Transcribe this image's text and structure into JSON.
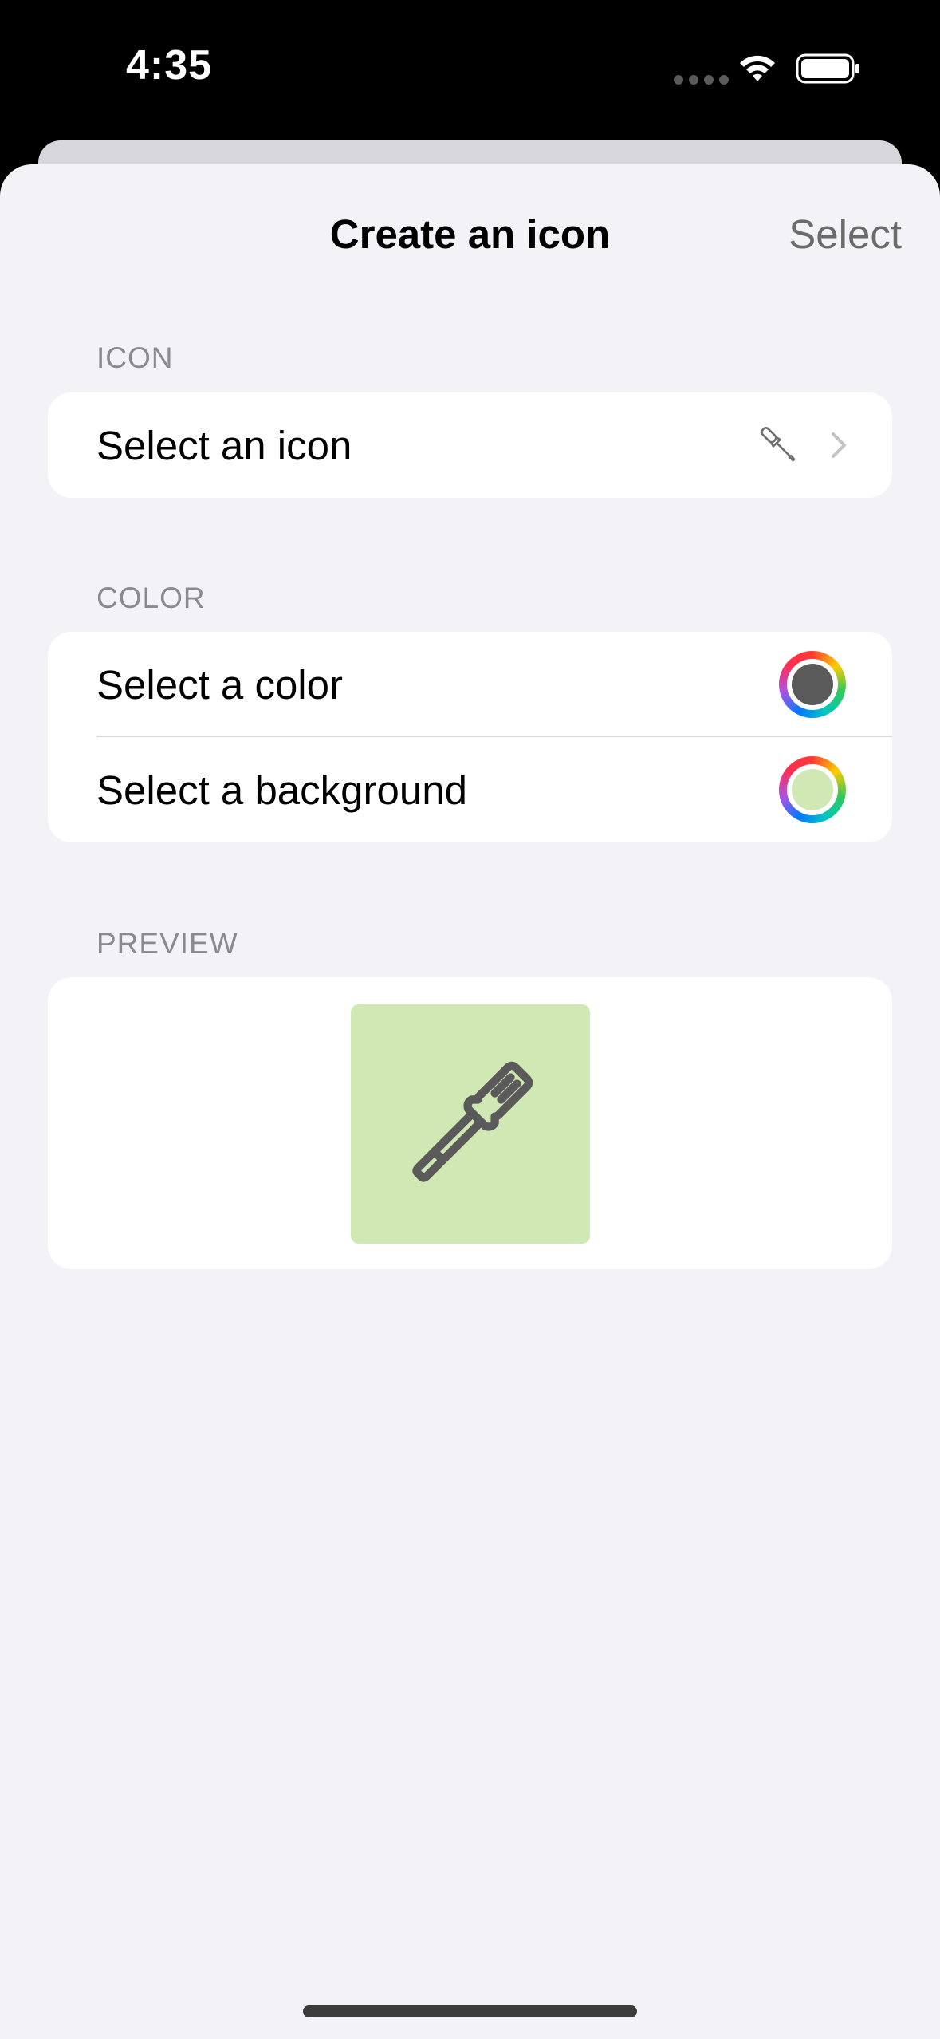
{
  "status_bar": {
    "time": "4:35",
    "wifi_icon": "wifi-icon",
    "battery_icon": "battery-icon"
  },
  "nav": {
    "title": "Create an icon",
    "action_label": "Select"
  },
  "icon_section": {
    "header": "ICON",
    "row_label": "Select an icon",
    "selected_icon": "screwdriver-icon"
  },
  "color_section": {
    "header": "COLOR",
    "rows": [
      {
        "label": "Select a color",
        "value": "#5a5a5a"
      },
      {
        "label": "Select a background",
        "value": "#cfe8b4"
      }
    ]
  },
  "preview_section": {
    "header": "PREVIEW",
    "icon": "screwdriver-icon",
    "icon_color": "#5a5a5a",
    "background_color": "#cfe8b4"
  }
}
